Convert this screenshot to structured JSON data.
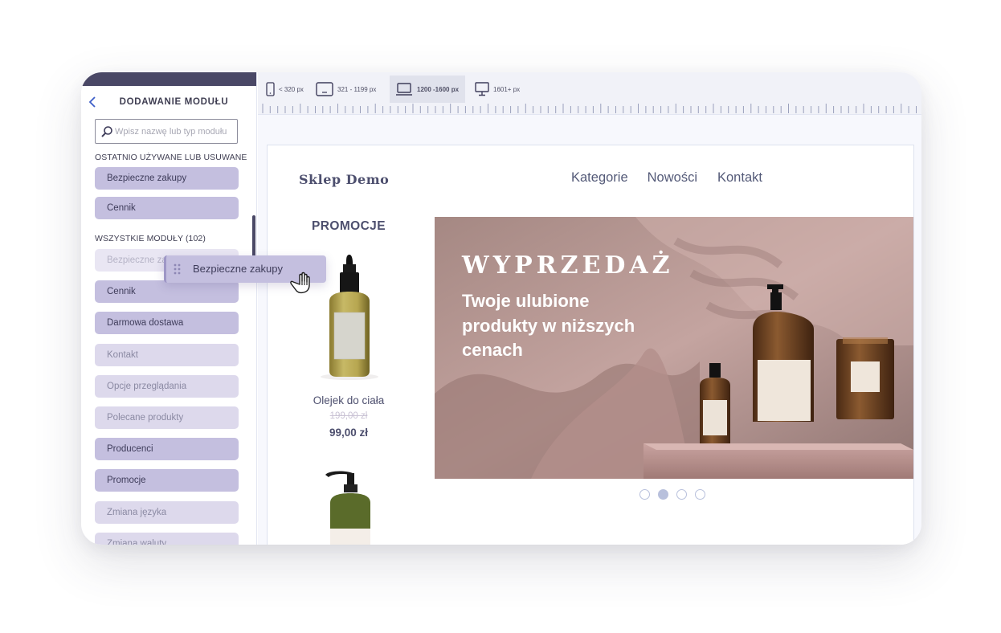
{
  "sidebar": {
    "title": "DODAWANIE MODUŁU",
    "search_placeholder": "Wpisz nazwę lub typ modułu",
    "recent_label": "OSTATNIO UŻYWANE LUB USUWANE",
    "recent_items": [
      {
        "label": "Bezpieczne zakupy"
      },
      {
        "label": "Cennik"
      }
    ],
    "all_label": "WSZYSTKIE MODUŁY (102)",
    "all_items": [
      {
        "label": "Bezpieczne zakupy",
        "state": "ghost"
      },
      {
        "label": "Cennik",
        "state": "active"
      },
      {
        "label": "Darmowa dostawa",
        "state": "active"
      },
      {
        "label": "Kontakt",
        "state": "inactive"
      },
      {
        "label": "Opcje przeglądania",
        "state": "inactive"
      },
      {
        "label": "Polecane produkty",
        "state": "inactive"
      },
      {
        "label": "Producenci",
        "state": "active"
      },
      {
        "label": "Promocje",
        "state": "active"
      },
      {
        "label": "Zmiana języka",
        "state": "inactive"
      },
      {
        "label": "Zmiana waluty",
        "state": "inactive"
      }
    ],
    "dragging_label": "Bezpieczne zakupy"
  },
  "device_bar": {
    "tabs": [
      {
        "label": "< 320 px",
        "icon": "phone-icon"
      },
      {
        "label": "321 - 1199 px",
        "icon": "tablet-icon"
      },
      {
        "label": "1200 -1600 px",
        "icon": "laptop-icon",
        "selected": true
      },
      {
        "label": "1601+ px",
        "icon": "desktop-icon"
      }
    ]
  },
  "preview": {
    "logo": "Sklep Demo",
    "nav": [
      "Kategorie",
      "Nowości",
      "Kontakt"
    ],
    "promo_heading": "PROMOCJE",
    "product": {
      "name": "Olejek do ciała",
      "old_price": "199,00 zł",
      "new_price": "99,00 zł"
    },
    "banner": {
      "title": "WYPRZEDAŻ",
      "subtitle": "Twoje ulubione produkty w niższych cenach"
    },
    "slider": {
      "count": 4,
      "active": 2
    }
  },
  "colors": {
    "sidebar_dark": "#4a4866",
    "module_active": "#c4bfdf",
    "module_inactive": "#ddd9ec",
    "text_dark": "#4d4f6e",
    "accent_blue": "#3e5ec8",
    "banner_pink": "#b8948f"
  }
}
